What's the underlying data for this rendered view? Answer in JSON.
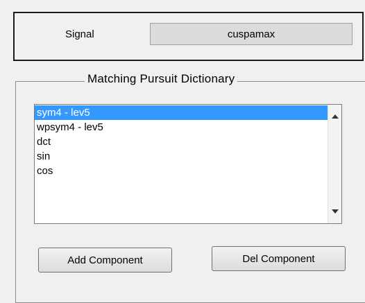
{
  "signal": {
    "label": "Signal",
    "value": "cuspamax"
  },
  "dictionary": {
    "title": "Matching Pursuit Dictionary",
    "items": [
      {
        "label": "sym4 - lev5",
        "selected": true
      },
      {
        "label": "wpsym4 - lev5",
        "selected": false
      },
      {
        "label": "dct",
        "selected": false
      },
      {
        "label": "sin",
        "selected": false
      },
      {
        "label": "cos",
        "selected": false
      }
    ],
    "scroll_up_icon": "arrow-up",
    "scroll_down_icon": "arrow-down",
    "selection_color": "#3399ff"
  },
  "buttons": {
    "add_label": "Add Component",
    "del_label": "Del Component"
  }
}
